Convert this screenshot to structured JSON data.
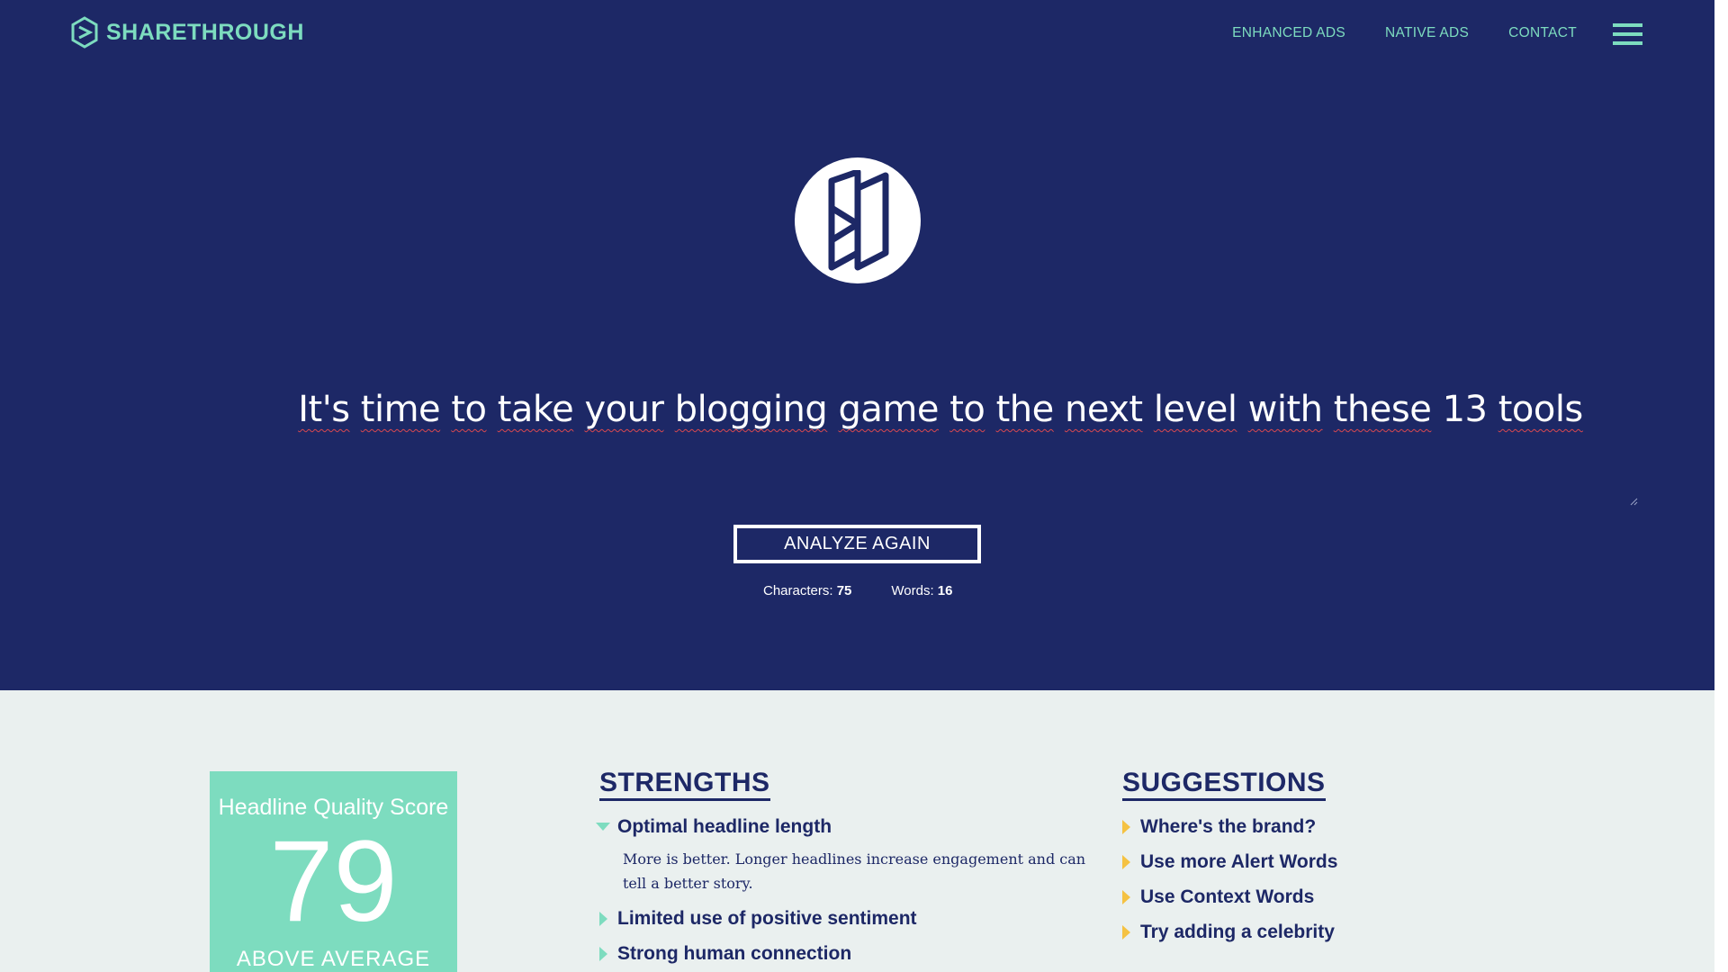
{
  "nav": {
    "brand": "SHARETHROUGH",
    "links": [
      "ENHANCED ADS",
      "NATIVE ADS",
      "CONTACT"
    ]
  },
  "analyzer": {
    "headline_words": [
      "It's",
      "time",
      "to",
      "take",
      "your",
      "blogging",
      "game",
      "to",
      "the",
      "next",
      "level",
      "with",
      "these",
      "13",
      "tools"
    ],
    "analyze_button": "ANALYZE AGAIN",
    "characters_label": "Characters:",
    "characters_value": "75",
    "words_label": "Words:",
    "words_value": "16"
  },
  "score": {
    "title": "Headline Quality Score",
    "value": "79",
    "rating": "ABOVE AVERAGE"
  },
  "strengths": {
    "heading": "STRENGTHS",
    "items": [
      {
        "label": "Optimal headline length",
        "expanded": true,
        "description": "More is better. Longer headlines increase engagement and can tell a better story."
      },
      {
        "label": "Limited use of positive sentiment",
        "expanded": false
      },
      {
        "label": "Strong human connection",
        "expanded": false
      }
    ]
  },
  "suggestions": {
    "heading": "SUGGESTIONS",
    "items": [
      {
        "label": "Where's the brand?"
      },
      {
        "label": "Use more Alert Words"
      },
      {
        "label": "Use Context Words"
      },
      {
        "label": "Try adding a celebrity"
      }
    ]
  },
  "colors": {
    "navy": "#1d2866",
    "mint": "#7ddcbf",
    "light_bg": "#eaf0ef",
    "suggestion_caret": "#f5c242",
    "spellcheck": "#d9484f"
  },
  "icons": {
    "logo": "sharethrough-hexagon-icon",
    "menu": "hamburger-menu-icon",
    "emblem": "headline-analyzer-emblem-icon",
    "expanded": "caret-down-icon",
    "collapsed": "caret-right-icon"
  }
}
